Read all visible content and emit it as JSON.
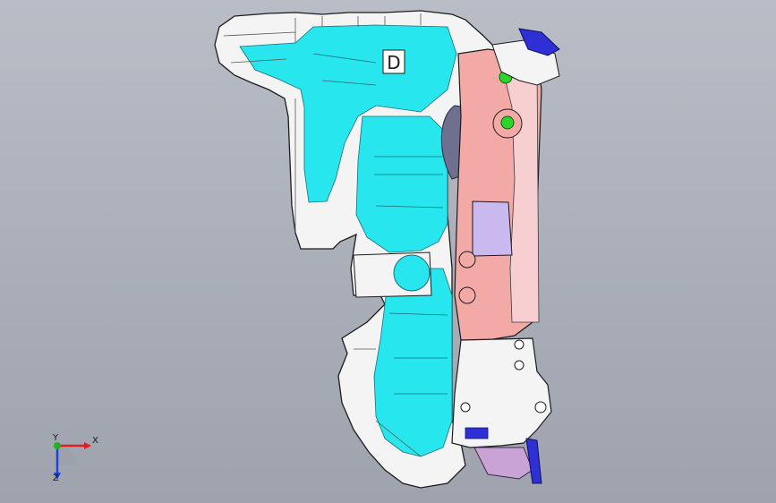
{
  "viewport": {
    "background_top": "#b9bdc6",
    "background_bottom": "#9ea3ae"
  },
  "model": {
    "colors": {
      "housing_fill": "#f4f4f4",
      "housing_edge": "#1c1c1c",
      "cavity_fill": "#27e6ee",
      "cover_fill": "#f3a9a6",
      "cover_light": "#f7cfd0",
      "lavender": "#c9b9ee",
      "bracket_blue": "#2f2fd6",
      "marker_green": "#2bd62b",
      "boss_shadow": "#8e8e9a"
    },
    "part_letter": "D"
  },
  "triad": {
    "x_label": "X",
    "y_label": "Y",
    "z_label": "Z",
    "x_color": "#e02020",
    "y_color": "#20b020",
    "z_color": "#2040e0"
  }
}
